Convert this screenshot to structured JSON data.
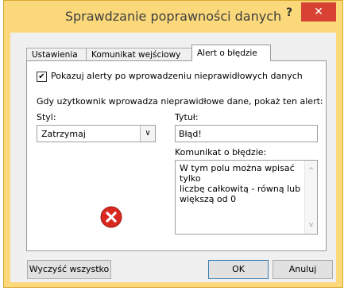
{
  "dialog": {
    "title": "Sprawdzanie poprawności danych",
    "help_label": "?",
    "close_label": "✕"
  },
  "tabs": [
    {
      "label": "Ustawienia",
      "active": false
    },
    {
      "label": "Komunikat wejściowy",
      "active": false
    },
    {
      "label": "Alert o błędzie",
      "active": true
    }
  ],
  "checkbox": {
    "checked": true,
    "mark": "✔",
    "label": "Pokazuj alerty po wprowadzeniu nieprawidłowych danych"
  },
  "section_label": "Gdy użytkownik wprowadza nieprawidłowe dane, pokaż ten alert:",
  "style": {
    "label": "Styl:",
    "value": "Zatrzymaj",
    "arrow": "∨"
  },
  "title_field": {
    "label": "Tytuł:",
    "value": "Błąd!"
  },
  "message": {
    "label": "Komunikat o błędzie:",
    "lines": [
      "W tym polu można wpisać tylko",
      "liczbę całkowitą - równą lub",
      "większą od 0"
    ],
    "scroll_up": "^",
    "scroll_down": "v"
  },
  "icon": {
    "name": "stop-error",
    "color": "#d9281f"
  },
  "buttons": {
    "clear": "Wyczyść wszystko",
    "ok": "OK",
    "cancel": "Anuluj"
  },
  "colors": {
    "title_bar": "#fbd97b",
    "close_button": "#d74233"
  }
}
